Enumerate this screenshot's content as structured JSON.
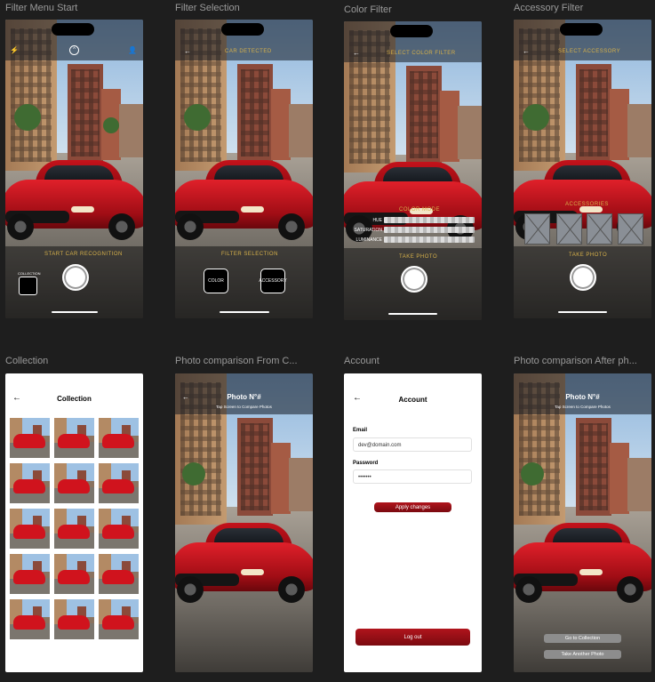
{
  "frames": [
    {
      "title": "Filter Menu Start",
      "start_label": "START CAR RECOGNITION",
      "collection_label": "COLLECTION"
    },
    {
      "title": "Filter Selection",
      "header": "CAR DETECTED",
      "section": "FILTER SELECTION",
      "color_btn": "COLOR",
      "accessory_btn": "ACCESSORY"
    },
    {
      "title": "Color Filter",
      "header": "SELECT COLOR FILTER",
      "section": "COLOR MODE",
      "sliders": [
        "HUE",
        "SATURATION",
        "LUMINANCE"
      ],
      "take_photo": "TAKE PHOTO"
    },
    {
      "title": "Accessory Filter",
      "header": "SELECT ACCESSORY",
      "section": "ACCESSORIES",
      "take_photo": "TAKE PHOTO"
    },
    {
      "title": "Collection",
      "heading": "Collection"
    },
    {
      "title": "Photo comparison From C...",
      "heading": "Photo N°#",
      "sub": "Tap Screen to Compare Photos"
    },
    {
      "title": "Account",
      "heading": "Account",
      "email_label": "Email",
      "email_value": "dev@domain.com",
      "password_label": "Password",
      "password_value": "•••••••",
      "apply": "Apply changes",
      "logout": "Log out"
    },
    {
      "title": "Photo comparison After ph...",
      "heading": "Photo N°#",
      "sub": "Tap Screen to Compare Photos",
      "goto": "Go to Collection",
      "another": "Take Another Photo"
    }
  ],
  "icons": {
    "back": "back-arrow-icon",
    "flash": "flash-icon",
    "chevron": "chevron-up-icon",
    "user": "user-icon"
  },
  "colors": {
    "accent_gold": "#d6b04a",
    "brand_red": "#9a0f16"
  }
}
